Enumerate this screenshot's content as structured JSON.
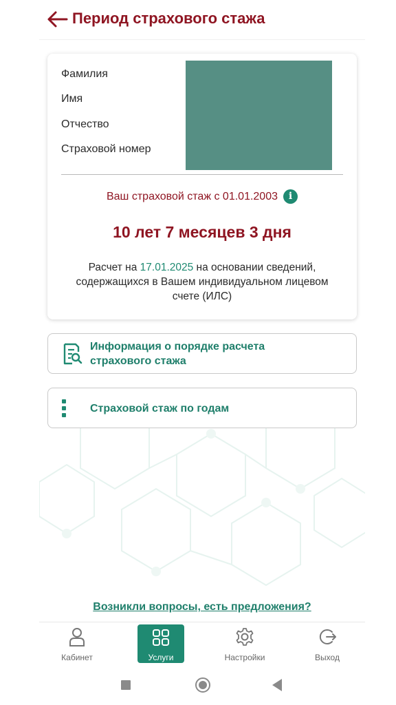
{
  "header": {
    "title": "Период страхового стажа",
    "back_icon": "arrow-left-icon"
  },
  "person_card": {
    "labels": [
      "Фамилия",
      "Имя",
      "Отчество",
      "Страховой номер"
    ],
    "stazh_since": "Ваш страховой стаж с 01.01.2003",
    "info_icon": "info-icon",
    "duration": "10 лет 7 месяцев 3 дня",
    "note_prefix": "Расчет на ",
    "note_date": "17.01.2025",
    "note_suffix": " на основании сведений, содержащихся в Вашем индивидуальном лицевом счете (ИЛС)",
    "redaction_color": "#568f84"
  },
  "actions": {
    "info_line1": "Информация о порядке расчета",
    "info_line2": "страхового стажа",
    "info_icon": "document-search-icon",
    "years_label": "Страховой стаж по годам",
    "years_icon": "dots-vertical-icon"
  },
  "feedback_link": "Возникли вопросы, есть предложения?",
  "tabbar": {
    "tabs": [
      {
        "label": "Кабинет",
        "icon": "person-icon"
      },
      {
        "label": "Услуги",
        "icon": "grid-icon",
        "active": true
      },
      {
        "label": "Настройки",
        "icon": "gear-icon"
      },
      {
        "label": "Выход",
        "icon": "logout-icon"
      }
    ]
  },
  "colors": {
    "brand_red": "#8f1522",
    "accent_green": "#1f8a72"
  }
}
